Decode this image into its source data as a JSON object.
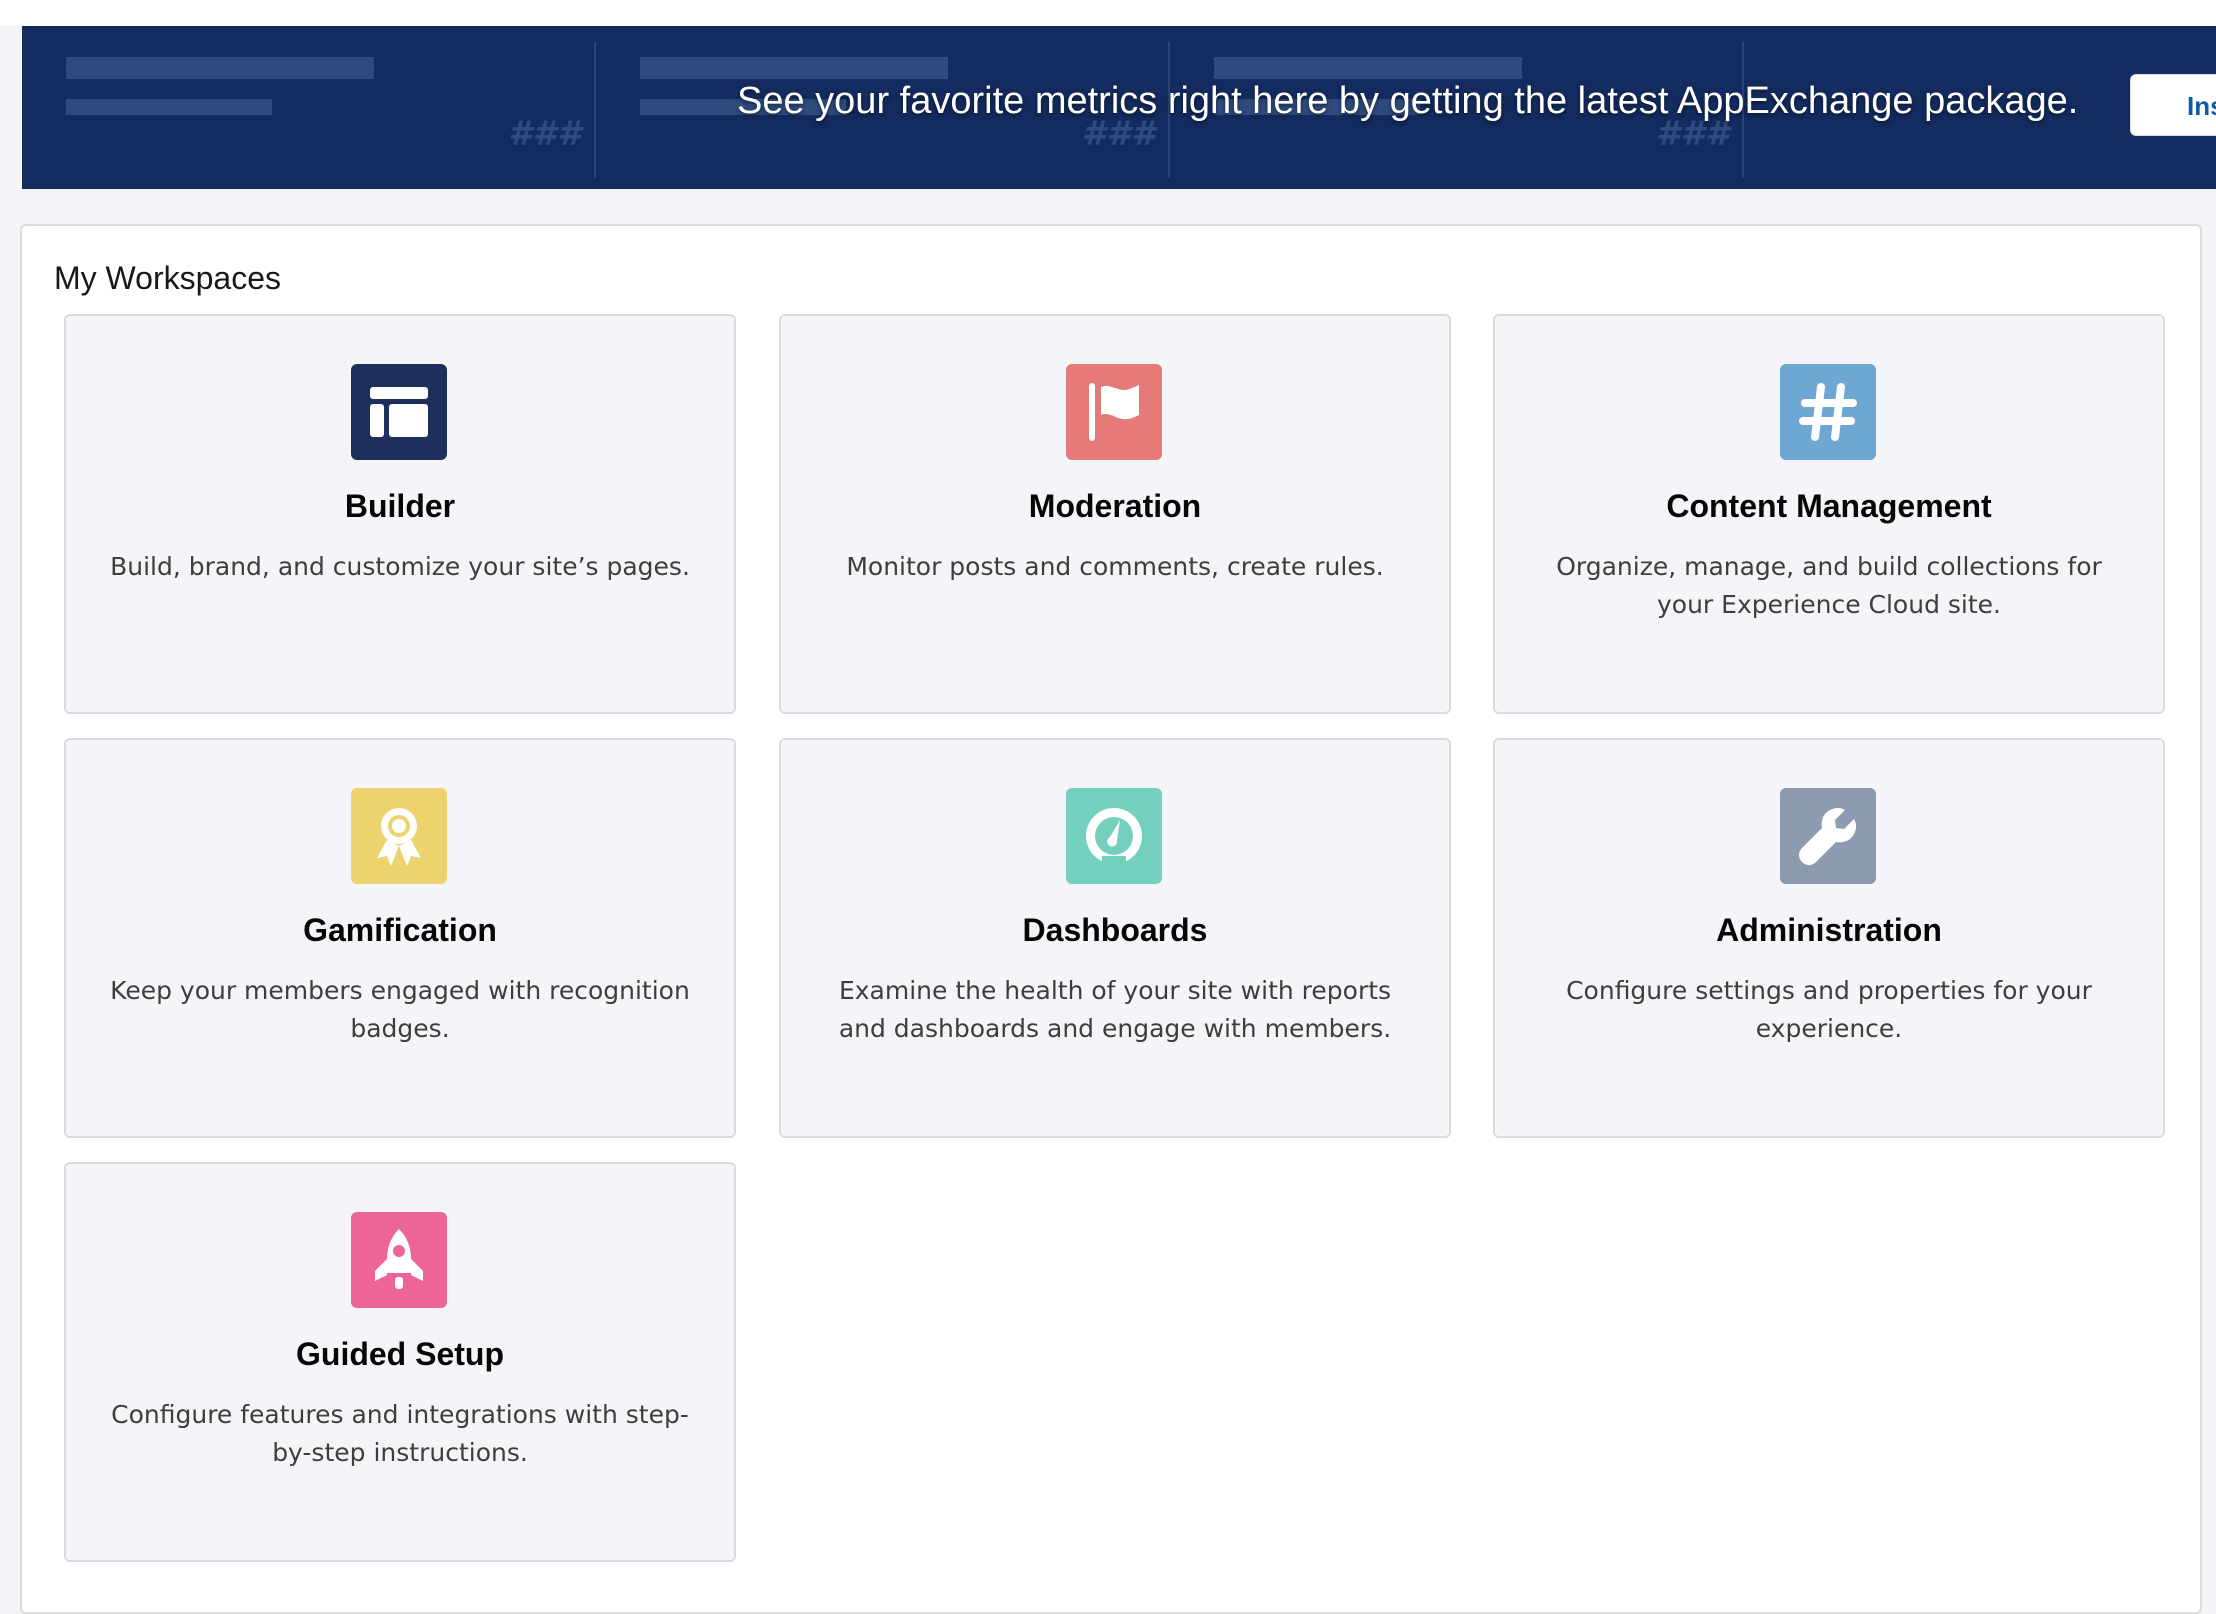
{
  "banner": {
    "metric_placeholder": "###",
    "message": "See your favorite metrics right here by getting the latest AppExchange package.",
    "install_label": "Install"
  },
  "workspaces": {
    "title": "My Workspaces",
    "items": [
      {
        "title": "Builder",
        "description": "Build, brand, and customize your site’s pages.",
        "icon": "layout-icon",
        "color": "#1f2f5c"
      },
      {
        "title": "Moderation",
        "description": "Monitor posts and comments, create rules.",
        "icon": "flag-icon",
        "color": "#e57a78"
      },
      {
        "title": "Content Management",
        "description": "Organize, manage, and build collections for your Experience Cloud site.",
        "icon": "hashtag-icon",
        "color": "#6ea7d2"
      },
      {
        "title": "Gamification",
        "description": "Keep your members engaged with recognition badges.",
        "icon": "badge-icon",
        "color": "#ecd36d"
      },
      {
        "title": "Dashboards",
        "description": "Examine the health of your site with reports and dashboards and engage with members.",
        "icon": "gauge-icon",
        "color": "#74d0be"
      },
      {
        "title": "Administration",
        "description": "Configure settings and properties for your experience.",
        "icon": "wrench-icon",
        "color": "#8d9bb1"
      },
      {
        "title": "Guided Setup",
        "description": "Configure features and integrations with step-by-step instructions.",
        "icon": "rocket-icon",
        "color": "#ed6597"
      }
    ]
  }
}
